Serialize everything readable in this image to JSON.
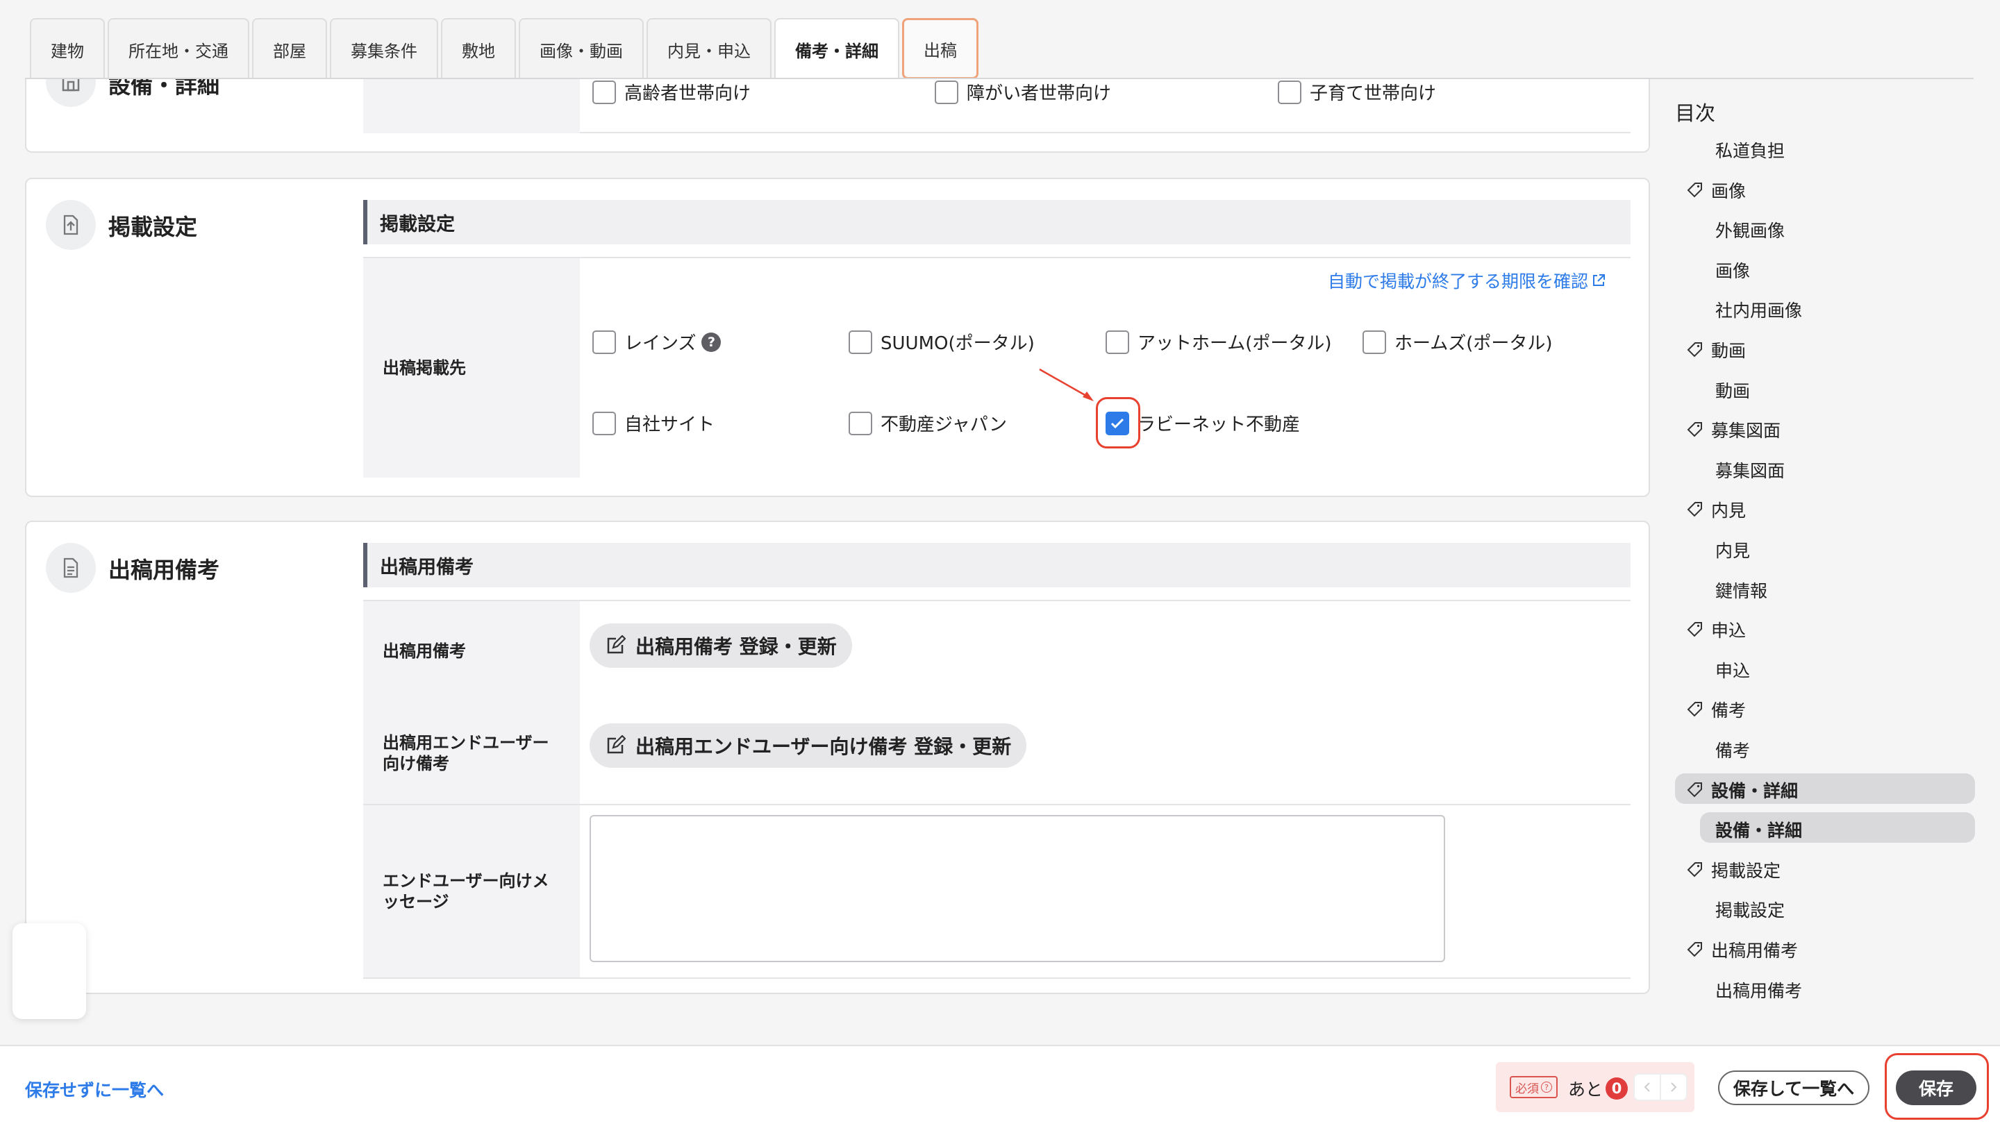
{
  "tabs": [
    "建物",
    "所在地・交通",
    "部屋",
    "募集条件",
    "敷地",
    "画像・動画",
    "内見・申込",
    "備考・詳細",
    "出稿"
  ],
  "top_section": {
    "title": "設備・詳細",
    "checkboxes": [
      "高齢者世帯向け",
      "障がい者世帯向け",
      "子育て世帯向け"
    ]
  },
  "listing": {
    "title": "掲載設定",
    "subhead": "掲載設定",
    "expiry_link": "自動で掲載が終了する期限を確認",
    "row_label": "出稿掲載先",
    "options": [
      {
        "label": "レインズ",
        "checked": false
      },
      {
        "label": "SUUMO(ポータル)",
        "checked": false
      },
      {
        "label": "アットホーム(ポータル)",
        "checked": false
      },
      {
        "label": "ホームズ(ポータル)",
        "checked": false
      },
      {
        "label": "自社サイト",
        "checked": false
      },
      {
        "label": "不動産ジャパン",
        "checked": false
      },
      {
        "label": "ラビーネット不動産",
        "checked": true
      }
    ],
    "help_glyph": "?"
  },
  "remarks": {
    "title": "出稿用備考",
    "subhead": "出稿用備考",
    "row1_label": "出稿用備考",
    "row1_button": "出稿用備考 登録・更新",
    "row2_label": "出稿用エンドユーザー向け備考",
    "row2_button": "出稿用エンドユーザー向け備考 登録・更新",
    "row3_label": "エンドユーザー向けメッセージ",
    "row3_value": ""
  },
  "toc": {
    "title": "目次",
    "items": [
      {
        "label": "私道負担",
        "level": 2
      },
      {
        "label": "画像",
        "level": 1
      },
      {
        "label": "外観画像",
        "level": 2
      },
      {
        "label": "画像",
        "level": 2
      },
      {
        "label": "社内用画像",
        "level": 2
      },
      {
        "label": "動画",
        "level": 1
      },
      {
        "label": "動画",
        "level": 2
      },
      {
        "label": "募集図面",
        "level": 1
      },
      {
        "label": "募集図面",
        "level": 2
      },
      {
        "label": "内見",
        "level": 1
      },
      {
        "label": "内見",
        "level": 2
      },
      {
        "label": "鍵情報",
        "level": 2
      },
      {
        "label": "申込",
        "level": 1
      },
      {
        "label": "申込",
        "level": 2
      },
      {
        "label": "備考",
        "level": 1
      },
      {
        "label": "備考",
        "level": 2
      },
      {
        "label": "設備・詳細",
        "level": 1,
        "active": true
      },
      {
        "label": "設備・詳細",
        "level": 2,
        "active": true
      },
      {
        "label": "掲載設定",
        "level": 1
      },
      {
        "label": "掲載設定",
        "level": 2
      },
      {
        "label": "出稿用備考",
        "level": 1
      },
      {
        "label": "出稿用備考",
        "level": 2
      }
    ]
  },
  "footer": {
    "back_link": "保存せずに一覧へ",
    "required_badge": "必須",
    "remaining_label": "あと",
    "remaining_count": "0",
    "save_and_list": "保存して一覧へ",
    "save": "保存"
  },
  "colors": {
    "accent_blue": "#2d7be8",
    "annotation_red": "#e8412f",
    "tab_outline": "#f0a27a",
    "dark_button": "#4a4a4e"
  }
}
